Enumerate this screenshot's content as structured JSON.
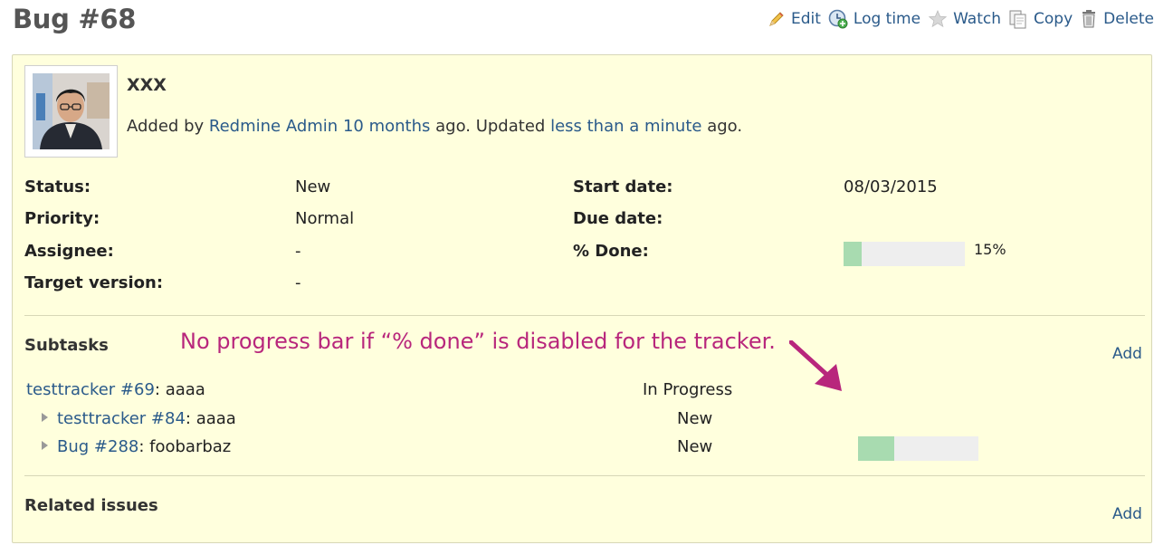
{
  "issue": {
    "title": "Bug #68",
    "subject": "XXX"
  },
  "actions": {
    "edit": "Edit",
    "log_time": "Log time",
    "watch": "Watch",
    "copy": "Copy",
    "delete": "Delete"
  },
  "author_line": {
    "added_by": "Added by",
    "author": "Redmine Admin",
    "created": "10 months",
    "ago_updated": "ago. Updated",
    "updated": "less than a minute",
    "ago": "ago."
  },
  "attributes": {
    "status_label": "Status:",
    "status_value": "New",
    "priority_label": "Priority:",
    "priority_value": "Normal",
    "assignee_label": "Assignee:",
    "assignee_value": "-",
    "target_label": "Target version:",
    "target_value": "-",
    "start_label": "Start date:",
    "start_value": "08/03/2015",
    "due_label": "Due date:",
    "due_value": "",
    "done_label": "% Done:",
    "done_value": "15%",
    "done_ratio": 0.15
  },
  "subtasks": {
    "title": "Subtasks",
    "add": "Add",
    "items": [
      {
        "link": "testtracker #69",
        "subject": ": aaaa",
        "status": "In Progress",
        "progress": null
      },
      {
        "link": "testtracker #84",
        "subject": ": aaaa",
        "status": "New",
        "progress": null
      },
      {
        "link": "Bug #288",
        "subject": ": foobarbaz",
        "status": "New",
        "progress": 0.3
      }
    ]
  },
  "annotation": {
    "text": "No progress bar if “% done” is disabled for the tracker."
  },
  "related": {
    "title": "Related issues",
    "add": "Add"
  },
  "colors": {
    "box_bg": "#ffffdd",
    "link": "#2a5a8a",
    "annotation": "#b8267c",
    "progress_done": "#a8dbb0"
  }
}
